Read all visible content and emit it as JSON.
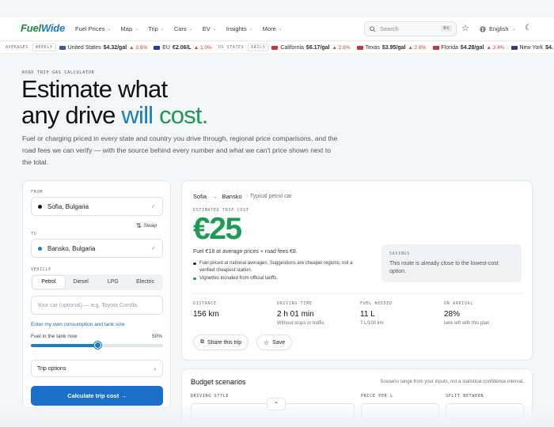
{
  "header": {
    "logo_left": "Fuel",
    "logo_right": "Wide",
    "nav": [
      "Fuel Prices",
      "Map",
      "Trip",
      "Cars",
      "EV",
      "Insights",
      "More"
    ],
    "search_placeholder": "Search",
    "search_shortcut": "⌘K",
    "language": "English"
  },
  "ticker": {
    "label": "AVERAGES",
    "badge_weekly": "WEEKLY",
    "items_weekly": [
      {
        "name": "United States",
        "price": "$4.32/gal",
        "change": "▲ 3.9%",
        "flag_color": "#3c5aa6"
      },
      {
        "name": "EU",
        "price": "€2.06/L",
        "change": "▲ 1.0%",
        "flag_color": "#1f3fa0"
      }
    ],
    "us_label": "US STATES",
    "badge_daily": "DAILY",
    "items_daily": [
      {
        "name": "California",
        "price": "$6.17/gal",
        "change": "▲ 2.8%",
        "flag_color": "#c43b2f"
      },
      {
        "name": "Texas",
        "price": "$3.95/gal",
        "change": "▲ 2.6%",
        "flag_color": "#c43b2f"
      },
      {
        "name": "Florida",
        "price": "$4.28/gal",
        "change": "▲ 3.4%",
        "flag_color": "#c43b2f"
      },
      {
        "name": "New York",
        "price": "$4.",
        "change": "",
        "flag_color": "#2b3f86"
      }
    ]
  },
  "hero": {
    "eyebrow": "ROAD TRIP GAS CALCULATOR",
    "title_line1": "Estimate what",
    "title_line2_a": "any drive ",
    "title_line2_b": "will ",
    "title_line2_c": "cost.",
    "subtitle": "Fuel or charging priced in every state and country you drive through, regional price comparisons, and the road fees we can verify — with the source behind every number and what we can't price shown next to the total."
  },
  "form": {
    "from_label": "FROM",
    "from_value": "Sofia, Bulgaria",
    "swap_label": "Swap",
    "to_label": "TO",
    "to_value": "Bansko, Bulgaria",
    "vehicle_label": "VEHICLE",
    "vehicle_options": [
      "Petrol",
      "Diesel",
      "LPG",
      "Electric"
    ],
    "vehicle_selected": "Petrol",
    "car_placeholder": "Your car (optional) — e.g. Toyota Corolla",
    "consumption_link": "Enter my own consumption and tank size",
    "tank_label": "Fuel in the tank now",
    "tank_percent_text": "50%",
    "tank_fraction": 0.5,
    "trip_options": "Trip options",
    "calculate_button": "Calculate trip cost →"
  },
  "result": {
    "from": "Sofia",
    "arrow": "→",
    "to": "Bansko",
    "vehicle_note": "· Typical petrol car",
    "estimate_label": "ESTIMATED TRIP COST",
    "total": "€25",
    "breakdown": "Fuel €18 at average prices + road fees €8.",
    "bullets": [
      {
        "text": "Fuel priced at national averages. Suggestions are cheaper regions, not a verified cheapest station.",
        "color": "#2a2e35"
      },
      {
        "text": "Vignettes included from official tariffs.",
        "color": "#1d9a56"
      }
    ],
    "savings_label": "SAVINGS",
    "savings_text": "This route is already close to the lowest-cost option.",
    "stats": [
      {
        "label": "DISTANCE",
        "value": "156 km",
        "sub": ""
      },
      {
        "label": "DRIVING TIME",
        "value": "2 h 01 min",
        "sub": "Without stops or traffic"
      },
      {
        "label": "FUEL NEEDED",
        "value": "11 L",
        "sub": "7 L/100 km"
      },
      {
        "label": "ON ARRIVAL",
        "value": "28%",
        "sub": "tank left with this plan"
      }
    ],
    "share_label": "Share this trip",
    "save_label": "Save"
  },
  "budget": {
    "title": "Budget scenarios",
    "note": "Scenario range from your inputs, not a statistical confidence interval.",
    "col_driving_style": "DRIVING STYLE",
    "col_price": "PRICE PER L",
    "col_split": "SPLIT BETWEEN"
  },
  "colors": {
    "accent_blue": "#1a7fc1",
    "accent_green": "#1d9a56",
    "button_blue": "#1a6fc9",
    "change_red": "#d2453a"
  }
}
